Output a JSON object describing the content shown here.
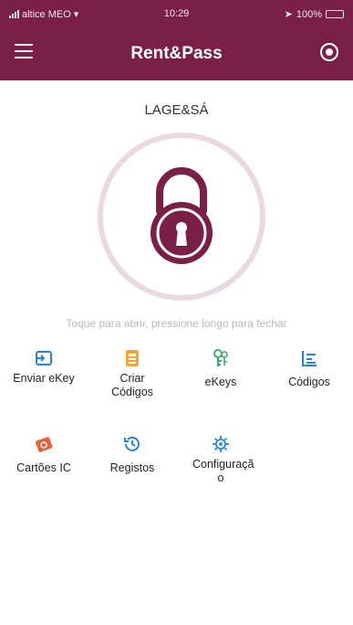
{
  "status_bar": {
    "carrier": "altice MEO",
    "time": "10:29",
    "battery": "100%",
    "battery_level": 1.0
  },
  "header": {
    "title": "Rent&Pass",
    "menu_icon": "hamburger-menu-icon",
    "right_icon": "record-toggle-icon"
  },
  "lock": {
    "name": "LAGE&SÁ",
    "hint": "Toque para abrir, pressione longo para fechar"
  },
  "actions": [
    {
      "label": "Enviar eKey",
      "icon": "send-ekey-icon",
      "color": "#2a82d8"
    },
    {
      "label": "Criar Códigos",
      "icon": "create-codes-icon",
      "color": "#f2a63a"
    },
    {
      "label": "eKeys",
      "icon": "ekeys-icon",
      "color": "#3fae69"
    },
    {
      "label": "Códigos",
      "icon": "codes-list-icon",
      "color": "#2a82d8"
    },
    {
      "label": "Cartões IC",
      "icon": "ic-card-icon",
      "color": "#e8603c"
    },
    {
      "label": "Registos",
      "icon": "records-clock-icon",
      "color": "#2a82d8"
    },
    {
      "label": "Configuraçã o",
      "icon": "settings-gear-icon",
      "color": "#3a8ed8"
    }
  ],
  "colors": {
    "brand": "#7a1f45",
    "ring": "#ead9e2"
  }
}
